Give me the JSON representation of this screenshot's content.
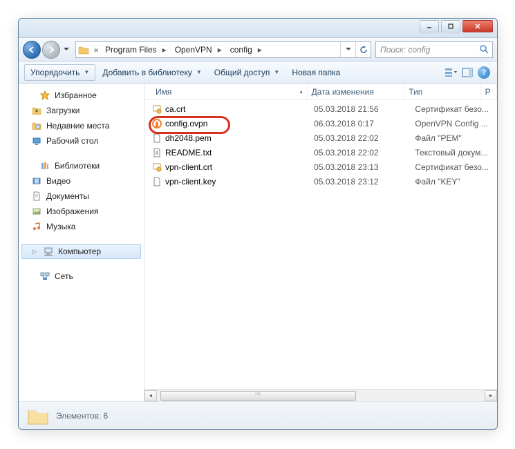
{
  "breadcrumb": {
    "item0": "Program Files",
    "item1": "OpenVPN",
    "item2": "config"
  },
  "search": {
    "placeholder": "Поиск: config"
  },
  "toolbar": {
    "organize": "Упорядочить",
    "add_library": "Добавить в библиотеку",
    "share": "Общий доступ",
    "new_folder": "Новая папка"
  },
  "sidebar": {
    "favorites": "Избранное",
    "downloads": "Загрузки",
    "recent": "Недавние места",
    "desktop": "Рабочий стол",
    "libraries": "Библиотеки",
    "videos": "Видео",
    "documents": "Документы",
    "pictures": "Изображения",
    "music": "Музыка",
    "computer": "Компьютер",
    "network": "Сеть"
  },
  "columns": {
    "name": "Имя",
    "date": "Дата изменения",
    "type": "Тип",
    "size": "Р"
  },
  "files": [
    {
      "name": "ca.crt",
      "date": "05.03.2018 21:56",
      "type": "Сертификат безо..."
    },
    {
      "name": "config.ovpn",
      "date": "06.03.2018 0:17",
      "type": "OpenVPN Config ..."
    },
    {
      "name": "dh2048.pem",
      "date": "05.03.2018 22:02",
      "type": "Файл \"PEM\""
    },
    {
      "name": "README.txt",
      "date": "05.03.2018 22:02",
      "type": "Текстовый докум..."
    },
    {
      "name": "vpn-client.crt",
      "date": "05.03.2018 23:13",
      "type": "Сертификат безо..."
    },
    {
      "name": "vpn-client.key",
      "date": "05.03.2018 23:12",
      "type": "Файл \"KEY\""
    }
  ],
  "status": {
    "label": "Элементов: 6"
  }
}
